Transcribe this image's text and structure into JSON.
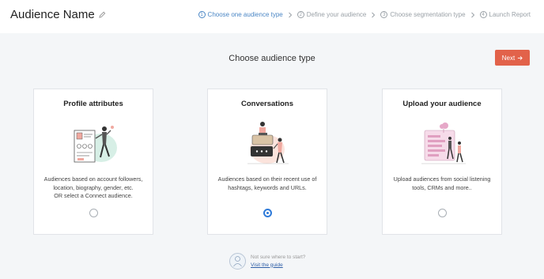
{
  "header": {
    "title": "Audience Name",
    "edit_icon": "pencil-icon"
  },
  "steps": [
    {
      "num": "1",
      "label": "Choose one audience type",
      "active": true
    },
    {
      "num": "2",
      "label": "Define your audience",
      "active": false
    },
    {
      "num": "3",
      "label": "Choose segmentation type",
      "active": false
    },
    {
      "num": "4",
      "label": "Launch Report",
      "active": false
    }
  ],
  "page": {
    "heading": "Choose audience type",
    "next_label": "Next",
    "next_icon": "arrow-right-icon"
  },
  "cards": [
    {
      "title": "Profile attributes",
      "desc": [
        "Audiences based on account followers,",
        "location, biography, gender, etc.",
        "OR select a Connect audience."
      ],
      "selected": false,
      "illustration": "profile-attributes-illustration"
    },
    {
      "title": "Conversations",
      "desc": [
        "Audiences based on their recent use of",
        "hashtags, keywords and URLs."
      ],
      "selected": true,
      "illustration": "conversations-illustration"
    },
    {
      "title": "Upload your audience",
      "desc": [
        "Upload audiences from social listening",
        "tools, CRMs and more.."
      ],
      "selected": false,
      "illustration": "upload-audience-illustration"
    }
  ],
  "help": {
    "question": "Not sure where to start?",
    "link": "Visit the guide"
  },
  "colors": {
    "accent": "#e2624a",
    "active_step": "#4a86c5",
    "radio_selected": "#2f7bd9",
    "link": "#2f5fa7"
  }
}
